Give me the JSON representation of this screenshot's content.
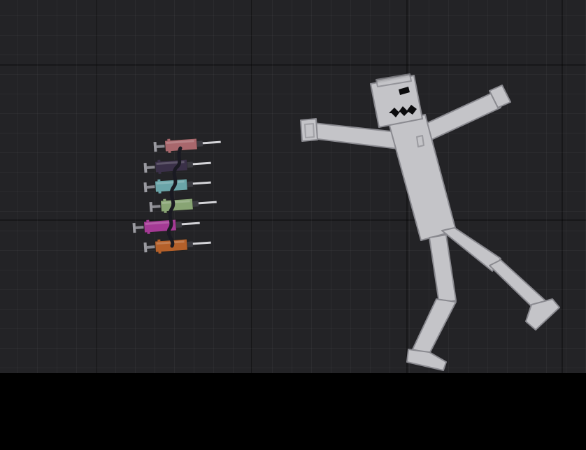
{
  "scene": {
    "background_color": "#232326",
    "grid_color": "#2b2b2f",
    "floor_color": "#000000"
  },
  "ragdoll": {
    "name": "human-ragdoll",
    "body_color": "#c4c4c8",
    "outline_color": "#8a8a90",
    "face_color": "#0b0b0d"
  },
  "syringes": [
    {
      "name": "syringe-pink",
      "color": "#a8676c"
    },
    {
      "name": "syringe-purple",
      "color": "#3a3048"
    },
    {
      "name": "syringe-teal",
      "color": "#6aa4a8"
    },
    {
      "name": "syringe-green",
      "color": "#88a474"
    },
    {
      "name": "syringe-magenta",
      "color": "#a43a94"
    },
    {
      "name": "syringe-orange",
      "color": "#b4602a"
    }
  ],
  "wire": {
    "name": "syringe-chain-wire",
    "color": "#1a1a22"
  }
}
